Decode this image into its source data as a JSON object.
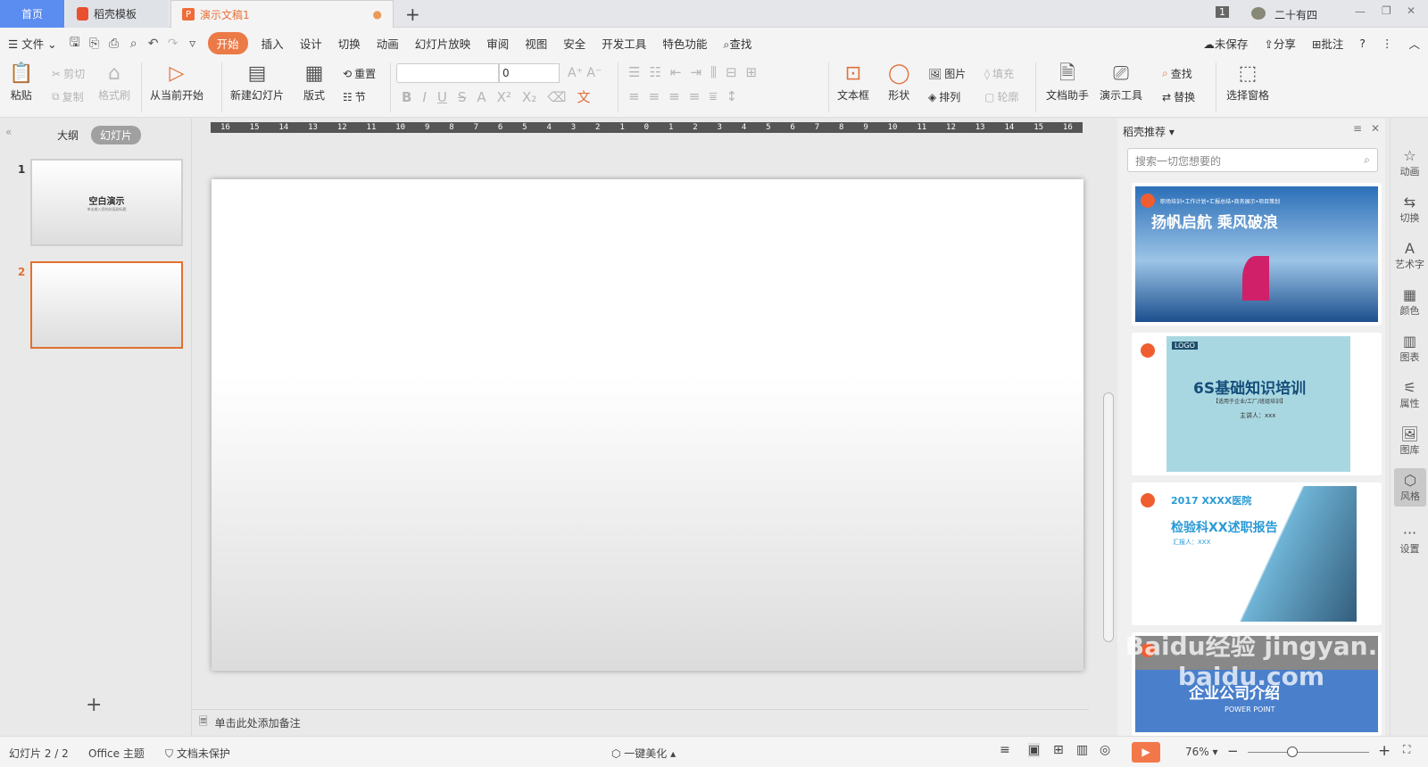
{
  "tabs": [
    {
      "label": "首页",
      "icon": "home"
    },
    {
      "label": "稻壳模板",
      "icon": "docer-logo"
    },
    {
      "label": "演示文稿1",
      "icon": "presentation-logo",
      "modified": true
    }
  ],
  "titlebar": {
    "badge": "1",
    "user": "二十有四"
  },
  "menu": {
    "file": "文件",
    "items": [
      "开始",
      "插入",
      "设计",
      "切换",
      "动画",
      "幻灯片放映",
      "审阅",
      "视图",
      "安全",
      "开发工具",
      "特色功能"
    ],
    "active": "开始",
    "search": "查找",
    "unsaved": "未保存",
    "share": "分享",
    "comment": "批注"
  },
  "ribbon": {
    "paste": "粘贴",
    "cut": "剪切",
    "copy": "复制",
    "format_painter": "格式刷",
    "from_current": "从当前开始",
    "new_slide": "新建幻灯片",
    "layout": "版式",
    "reset": "重置",
    "section": "节",
    "font_size": "0",
    "textbox": "文本框",
    "shape": "形状",
    "picture": "图片",
    "arrange": "排列",
    "fill": "填充",
    "outline": "轮廓",
    "doc_helper": "文档助手",
    "present_tools": "演示工具",
    "find": "查找",
    "replace": "替换",
    "selection_pane": "选择窗格"
  },
  "left_panel": {
    "outline_tab": "大纲",
    "slides_tab": "幻灯片",
    "slides": [
      {
        "num": "1",
        "title": "空白演示",
        "subtitle": "单击输入您的封面副标题"
      },
      {
        "num": "2",
        "title": ""
      }
    ],
    "selected": 2
  },
  "ruler": [
    "16",
    "15",
    "14",
    "13",
    "12",
    "11",
    "10",
    "9",
    "8",
    "7",
    "6",
    "5",
    "4",
    "3",
    "2",
    "1",
    "0",
    "1",
    "2",
    "3",
    "4",
    "5",
    "6",
    "7",
    "8",
    "9",
    "10",
    "11",
    "12",
    "13",
    "14",
    "15",
    "16"
  ],
  "notes_placeholder": "单击此处添加备注",
  "right_panel": {
    "title": "稻壳推荐",
    "search_placeholder": "搜索一切您想要的",
    "templates": [
      {
        "title": "扬帆启航 乘风破浪",
        "subtitle": "职场培训•工作计划•汇报总结•商务展示•项目策划"
      },
      {
        "title": "6S基础知识培训",
        "subtitle": "【适用于企业/工厂/班组培训】",
        "extra": "主讲人：xxx",
        "logo": "LOGO"
      },
      {
        "title": "检验科XX述职报告",
        "subtitle": "汇报人：XXX",
        "extra": "2017 XXXX医院"
      },
      {
        "title": "企业公司介绍",
        "subtitle": "POWER POINT"
      }
    ]
  },
  "sidebar": [
    "动画",
    "切换",
    "艺术字",
    "颜色",
    "图表",
    "属性",
    "图库",
    "风格",
    "设置"
  ],
  "status": {
    "slide": "幻灯片 2 / 2",
    "theme": "Office 主题",
    "protect": "文档未保护",
    "beautify": "一键美化",
    "zoom": "76%"
  },
  "zoom_level": 76,
  "watermark": "Baidu经验 jingyan.baidu.com",
  "colors": {
    "accent": "#ec7a46",
    "home_tab": "#5b8cf0"
  }
}
